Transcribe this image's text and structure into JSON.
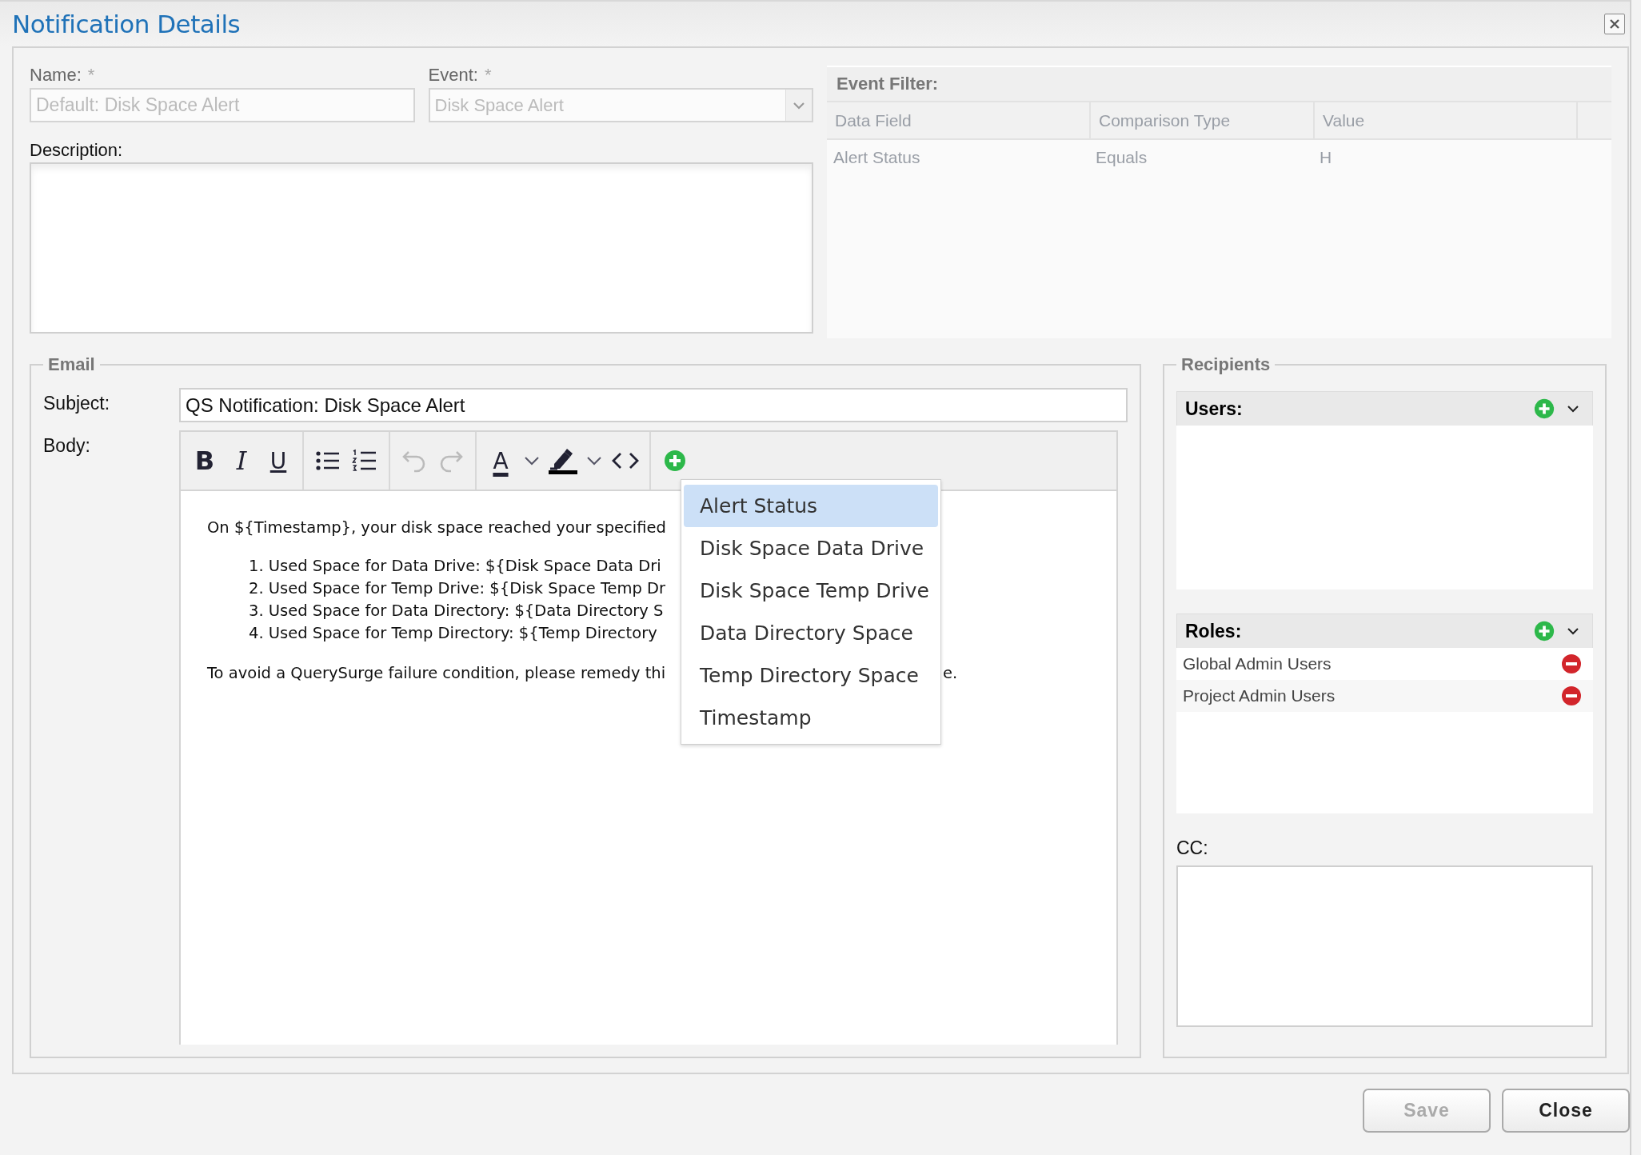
{
  "window": {
    "title": "Notification Details"
  },
  "name": {
    "label": "Name:",
    "required_mark": "*",
    "value": "Default: Disk Space Alert",
    "disabled": true
  },
  "event": {
    "label": "Event:",
    "required_mark": "*",
    "value": "Disk Space Alert",
    "disabled": true
  },
  "description": {
    "label": "Description:"
  },
  "event_filter": {
    "title": "Event Filter:",
    "columns": [
      "Data Field",
      "Comparison Type",
      "Value"
    ],
    "rows": [
      [
        "Alert Status",
        "Equals",
        "H"
      ]
    ]
  },
  "email": {
    "legend": "Email",
    "subject_label": "Subject:",
    "subject": "QS Notification: Disk Space Alert",
    "body_label": "Body:",
    "toolbar": {
      "format_glyphs": [
        "B",
        "I",
        "U"
      ],
      "color_glyph": "A",
      "undo_disabled": true,
      "redo_disabled": true
    },
    "body": {
      "intro": "On ${Timestamp}, your disk space reached your specified",
      "list": [
        "1. Used Space for Data Drive: ${Disk Space Data Dri",
        "2. Used Space for Temp Drive: ${Disk Space Temp Dr",
        "3. Used Space for Data Directory: ${Data Directory S",
        "4. Used Space for Temp Directory: ${Temp Directory"
      ],
      "closing": "To avoid a QuerySurge failure condition, please remedy thi",
      "closing_tail": "e."
    },
    "insert_menu": [
      {
        "label": "Alert Status",
        "selected": true
      },
      {
        "label": "Disk Space Data Drive",
        "selected": false
      },
      {
        "label": "Disk Space Temp Drive",
        "selected": false
      },
      {
        "label": "Data Directory Space",
        "selected": false
      },
      {
        "label": "Temp Directory Space",
        "selected": false
      },
      {
        "label": "Timestamp",
        "selected": false
      }
    ]
  },
  "recipients": {
    "legend": "Recipients",
    "users": {
      "title": "Users:"
    },
    "roles": {
      "title": "Roles:",
      "items": [
        "Global Admin Users",
        "Project Admin Users"
      ]
    },
    "cc_label": "CC:"
  },
  "buttons": [
    {
      "label": "Save",
      "disabled": true
    },
    {
      "label": "Close",
      "disabled": false
    }
  ]
}
